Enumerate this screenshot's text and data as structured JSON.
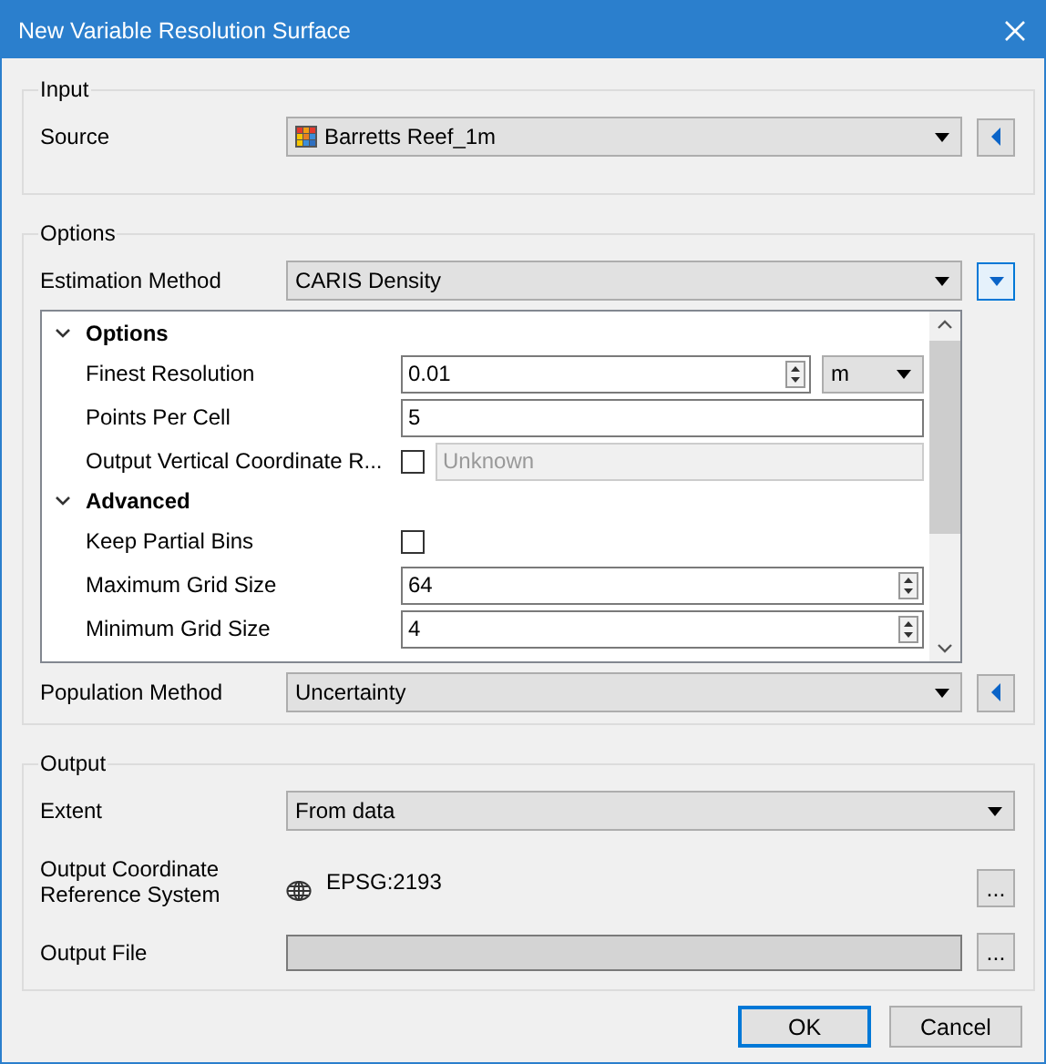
{
  "window": {
    "title": "New Variable Resolution Surface"
  },
  "input": {
    "title": "Input",
    "source": {
      "label": "Source",
      "value": "Barretts Reef_1m",
      "expanded": false
    }
  },
  "options": {
    "title": "Options",
    "estimation_method": {
      "label": "Estimation Method",
      "value": "CARIS Density",
      "expanded": true
    },
    "properties": [
      {
        "label": "Options",
        "expanded": true,
        "children": [
          {
            "kind": "spin",
            "label": "Finest Resolution",
            "value": "0.01",
            "unit": "m"
          },
          {
            "kind": "text",
            "label": "Points Per Cell",
            "value": "5"
          },
          {
            "kind": "check-field",
            "label": "Output Vertical Coordinate R...",
            "checked": false,
            "value": "Unknown",
            "disabled": true
          }
        ]
      },
      {
        "label": "Advanced",
        "expanded": true,
        "children": [
          {
            "kind": "check",
            "label": "Keep Partial Bins",
            "checked": false
          },
          {
            "kind": "spin",
            "label": "Maximum Grid Size",
            "value": "64"
          },
          {
            "kind": "spin",
            "label": "Minimum Grid Size",
            "value": "4"
          }
        ]
      }
    ],
    "population_method": {
      "label": "Population Method",
      "value": "Uncertainty",
      "expanded": false
    }
  },
  "output": {
    "title": "Output",
    "extent": {
      "label": "Extent",
      "value": "From data"
    },
    "crs": {
      "label": "Output Coordinate Reference System",
      "value": "EPSG:2193",
      "button": "..."
    },
    "file": {
      "label": "Output File",
      "button": "..."
    }
  },
  "buttons": [
    {
      "label": "OK",
      "default": true
    },
    {
      "label": "Cancel",
      "default": false
    }
  ]
}
